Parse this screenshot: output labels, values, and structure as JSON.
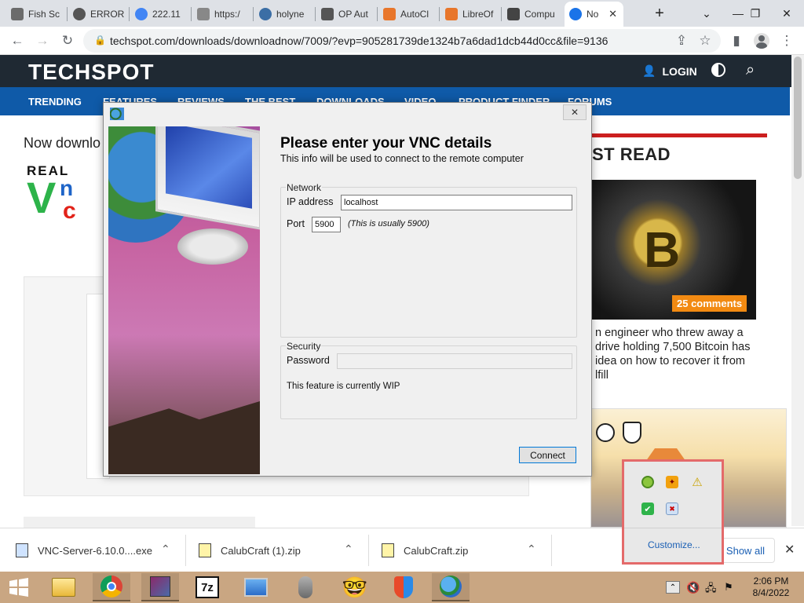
{
  "browser": {
    "tabs": [
      {
        "label": "Fish Sc",
        "icon": "fish-icon",
        "color": "#6b6b6b"
      },
      {
        "label": "ERROR",
        "icon": "globe-icon",
        "color": "#555"
      },
      {
        "label": "222.11",
        "icon": "google-icon",
        "color": "#4285f4"
      },
      {
        "label": "https:/",
        "icon": "page-icon",
        "color": "#888"
      },
      {
        "label": "holyne",
        "icon": "globe-icon",
        "color": "#3b6ea5"
      },
      {
        "label": "OP Aut",
        "icon": "shield-icon",
        "color": "#555"
      },
      {
        "label": "AutoCl",
        "icon": "diamond-icon",
        "color": "#e8762b"
      },
      {
        "label": "LibreOf",
        "icon": "diamond-icon",
        "color": "#e8762b"
      },
      {
        "label": "Compu",
        "icon": "shield-icon",
        "color": "#444"
      },
      {
        "label": "No",
        "icon": "techspot-icon",
        "color": "#1a73e8",
        "active": true
      }
    ],
    "url": "techspot.com/downloads/downloadnow/7009/?evp=905281739de1324b7a6dad1dcb44d0cc&file=9136"
  },
  "techspot": {
    "logo": "TECHSPOT",
    "login": "LOGIN",
    "nav": [
      "TRENDING",
      "FEATURES",
      "REVIEWS",
      "THE BEST",
      "DOWNLOADS",
      "VIDEO",
      "PRODUCT FINDER",
      "FORUMS"
    ],
    "page_heading": "Now downlo",
    "realvnc_word": "REAL",
    "sidebar_title": "ST READ",
    "comments_badge": "25 comments",
    "article_lines": [
      "n engineer who threw away a",
      "drive holding 7,500 Bitcoin has",
      "idea on how to recover it from",
      "lfill"
    ]
  },
  "dialog": {
    "title": "Please enter your VNC details",
    "subtitle": "This info will be used to connect to the remote computer",
    "network_label": "Network",
    "ip_label": "IP address",
    "ip_value": "localhost",
    "port_label": "Port",
    "port_value": "5900",
    "port_hint": "(This is usually 5900)",
    "security_label": "Security",
    "password_label": "Password",
    "wip_note": "This feature is currently WIP",
    "connect_label": "Connect"
  },
  "downloads": {
    "items": [
      {
        "name": "VNC-Server-6.10.0....exe"
      },
      {
        "name": "CalubCraft (1).zip"
      },
      {
        "name": "CalubCraft.zip"
      }
    ],
    "show_all": "Show all"
  },
  "tray": {
    "customize": "Customize..."
  },
  "taskbar": {
    "time": "2:06 PM",
    "date": "8/4/2022",
    "sevenzip_label": "7z"
  }
}
